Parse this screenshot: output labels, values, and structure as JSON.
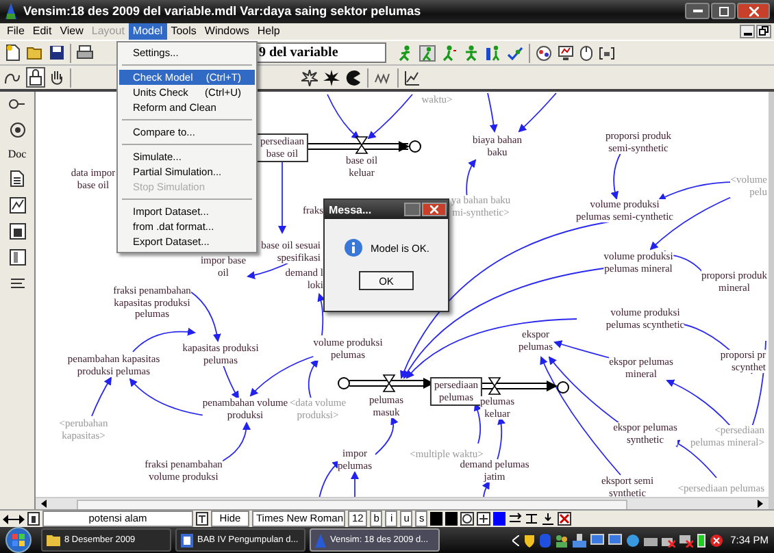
{
  "window": {
    "title": "Vensim:18 des 2009 del variable.mdl Var:daya saing sektor pelumas"
  },
  "menu_bar": [
    {
      "label": "File",
      "selected": false,
      "disabled": false
    },
    {
      "label": "Edit",
      "selected": false,
      "disabled": false
    },
    {
      "label": "View",
      "selected": false,
      "disabled": false
    },
    {
      "label": "Layout",
      "selected": false,
      "disabled": true
    },
    {
      "label": "Model",
      "selected": true,
      "disabled": false
    },
    {
      "label": "Tools",
      "selected": false,
      "disabled": false
    },
    {
      "label": "Windows",
      "selected": false,
      "disabled": false
    },
    {
      "label": "Help",
      "selected": false,
      "disabled": false
    }
  ],
  "model_menu": [
    {
      "kind": "item",
      "label": "Settings...",
      "selected": false,
      "disabled": false
    },
    {
      "kind": "separator"
    },
    {
      "kind": "item",
      "label": "Check Model",
      "shortcut": "(Ctrl+T)",
      "selected": true,
      "disabled": false
    },
    {
      "kind": "item",
      "label": "Units Check",
      "shortcut": "(Ctrl+U)",
      "selected": false,
      "disabled": false
    },
    {
      "kind": "item",
      "label": "Reform and Clean",
      "selected": false,
      "disabled": false
    },
    {
      "kind": "separator"
    },
    {
      "kind": "item",
      "label": "Compare to...",
      "selected": false,
      "disabled": false
    },
    {
      "kind": "separator"
    },
    {
      "kind": "item",
      "label": "Simulate...",
      "selected": false,
      "disabled": false
    },
    {
      "kind": "item",
      "label": "Partial Simulation...",
      "selected": false,
      "disabled": false
    },
    {
      "kind": "item",
      "label": "Stop Simulation",
      "selected": false,
      "disabled": true
    },
    {
      "kind": "separator"
    },
    {
      "kind": "item",
      "label": "Import Dataset...",
      "selected": false,
      "disabled": false
    },
    {
      "kind": "item",
      "label": "from .dat format...",
      "selected": false,
      "disabled": false
    },
    {
      "kind": "item",
      "label": "Export Dataset...",
      "selected": false,
      "disabled": false
    }
  ],
  "toolbar": {
    "variable_field": "9 del variable"
  },
  "sketch_tools": {
    "doc_label": "Doc"
  },
  "diagram": {
    "nodes": [
      {
        "kind": "aux",
        "text": "data impor\nbase oil"
      },
      {
        "kind": "level",
        "text": "persediaan\nbase oil"
      },
      {
        "kind": "aux",
        "text": "base oil\nkeluar"
      },
      {
        "kind": "shadow",
        "text": "waktu>"
      },
      {
        "kind": "aux",
        "text": "biaya bahan\nbaku"
      },
      {
        "kind": "shadow",
        "text": "ya bahan baku\nmi-synthetic>"
      },
      {
        "kind": "aux",
        "text": "proporsi produk\nsemi-synthetic"
      },
      {
        "kind": "shadow",
        "text": "<volume\npelu"
      },
      {
        "kind": "aux",
        "text": "fraks"
      },
      {
        "kind": "aux",
        "text": "volume produksi\npelumas semi-cynthetic"
      },
      {
        "kind": "aux",
        "text": "base oil sesuai\nspesifikasi"
      },
      {
        "kind": "aux",
        "text": "impor base\noil"
      },
      {
        "kind": "aux",
        "text": "demand l\nloki"
      },
      {
        "kind": "aux",
        "text": "volume produksi\npelumas mineral"
      },
      {
        "kind": "aux",
        "text": "proporsi produk\nmineral"
      },
      {
        "kind": "aux",
        "text": "fraksi penambahan\nkapasitas produksi\npelumas"
      },
      {
        "kind": "aux",
        "text": "volume produksi\npelumas scynthetic"
      },
      {
        "kind": "aux",
        "text": "kapasitas produksi\npelumas"
      },
      {
        "kind": "aux",
        "text": "volume produksi\npelumas"
      },
      {
        "kind": "aux",
        "text": "penambahan kapasitas\nproduksi pelumas"
      },
      {
        "kind": "aux",
        "text": "proporsi pr\nscynthet"
      },
      {
        "kind": "aux",
        "text": "ekspor\npelumas"
      },
      {
        "kind": "aux",
        "text": "ekspor pelumas\nmineral"
      },
      {
        "kind": "aux",
        "text": "penambahan volume\nproduksi"
      },
      {
        "kind": "shadow",
        "text": "<data volume\nproduksi>"
      },
      {
        "kind": "aux",
        "text": "pelumas\nmasuk"
      },
      {
        "kind": "level",
        "text": "persediaan\npelumas"
      },
      {
        "kind": "aux",
        "text": "pelumas\nkeluar"
      },
      {
        "kind": "shadow",
        "text": "<perubahan\nkapasitas>"
      },
      {
        "kind": "aux",
        "text": "ekspor pelumas\nsynthetic"
      },
      {
        "kind": "shadow",
        "text": "<persediaan\npelumas mineral>"
      },
      {
        "kind": "aux",
        "text": "fraksi penambahan\nvolume produksi"
      },
      {
        "kind": "aux",
        "text": "impor\npelumas"
      },
      {
        "kind": "shadow",
        "text": "<multiple waktu>"
      },
      {
        "kind": "aux",
        "text": "demand pelumas\njatim"
      },
      {
        "kind": "aux",
        "text": "eksport semi\nsynthetic"
      },
      {
        "kind": "shadow",
        "text": "<persediaan pelumas"
      }
    ]
  },
  "dialog": {
    "title": "Messa...",
    "message": "Model is OK.",
    "button": "OK"
  },
  "status_bar": {
    "view_name": "potensi alam",
    "hide": "Hide",
    "font": "Times New Roman",
    "size": "12",
    "styles": [
      "b",
      "i",
      "u",
      "s"
    ]
  },
  "taskbar": {
    "tasks": [
      {
        "label": "8 Desember 2009",
        "selected": false
      },
      {
        "label": "BAB IV Pengumpulan d...",
        "selected": false
      },
      {
        "label": "Vensim: 18 des 2009 d...",
        "selected": true
      }
    ],
    "clock": "7:34 PM"
  }
}
